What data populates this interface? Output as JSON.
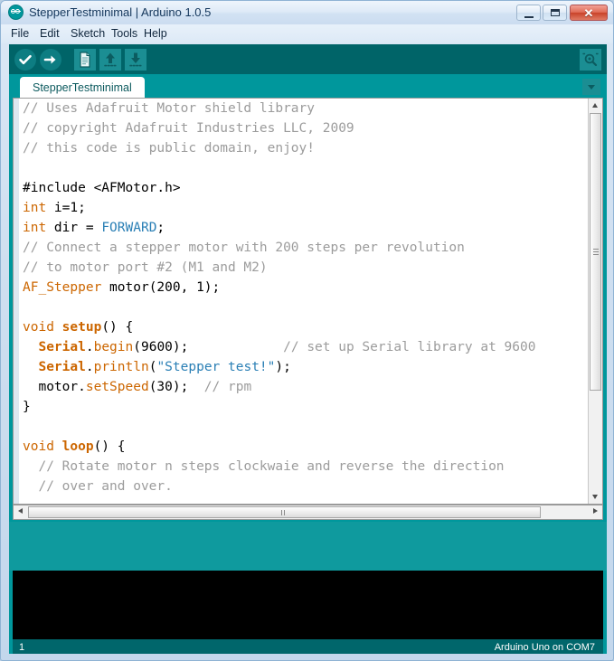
{
  "window": {
    "title": "StepperTestminimal | Arduino 1.0.5",
    "app_icon": "arduino-logo-icon",
    "controls": {
      "minimize": "minimize-icon",
      "maximize": "maximize-icon",
      "close_label": "✕"
    }
  },
  "menubar": {
    "items": [
      {
        "label": "File"
      },
      {
        "label": "Edit"
      },
      {
        "label": "Sketch"
      },
      {
        "label": "Tools"
      },
      {
        "label": "Help"
      }
    ]
  },
  "toolbar": {
    "buttons": [
      {
        "name": "verify-button",
        "icon": "checkmark-icon",
        "tooltip": "Verify"
      },
      {
        "name": "upload-button",
        "icon": "arrow-right-icon",
        "tooltip": "Upload"
      },
      {
        "name": "new-button",
        "icon": "document-icon",
        "tooltip": "New"
      },
      {
        "name": "open-button",
        "icon": "arrow-up-icon",
        "tooltip": "Open"
      },
      {
        "name": "save-button",
        "icon": "arrow-down-icon",
        "tooltip": "Save"
      }
    ],
    "serial_monitor": {
      "name": "serial-monitor-button",
      "icon": "magnifier-icon",
      "tooltip": "Serial Monitor"
    }
  },
  "tabbar": {
    "active_tab": "StepperTestminimal",
    "menu_icon": "chevron-down-icon"
  },
  "editor": {
    "lines": [
      [
        {
          "t": "// Uses Adafruit Motor shield library",
          "c": "cm"
        }
      ],
      [
        {
          "t": "// copyright Adafruit Industries LLC, 2009",
          "c": "cm"
        }
      ],
      [
        {
          "t": "// this code is public domain, enjoy!",
          "c": "cm"
        }
      ],
      [],
      [
        {
          "t": "#include <AFMotor.h>",
          "c": "pl"
        }
      ],
      [
        {
          "t": "int",
          "c": "kw"
        },
        {
          "t": " i=1;",
          "c": "pl"
        }
      ],
      [
        {
          "t": "int",
          "c": "kw"
        },
        {
          "t": " dir = ",
          "c": "pl"
        },
        {
          "t": "FORWARD",
          "c": "lit"
        },
        {
          "t": ";",
          "c": "pl"
        }
      ],
      [
        {
          "t": "// Connect a stepper motor with 200 steps per revolution",
          "c": "cm"
        }
      ],
      [
        {
          "t": "// to motor port #2 (M1 and M2)",
          "c": "cm"
        }
      ],
      [
        {
          "t": "AF_Stepper",
          "c": "kw"
        },
        {
          "t": " motor(200, 1);",
          "c": "pl"
        }
      ],
      [],
      [
        {
          "t": "void",
          "c": "kw"
        },
        {
          "t": " ",
          "c": "pl"
        },
        {
          "t": "setup",
          "c": "kwb"
        },
        {
          "t": "() {",
          "c": "pl"
        }
      ],
      [
        {
          "t": "  ",
          "c": "pl"
        },
        {
          "t": "Serial",
          "c": "kwb"
        },
        {
          "t": ".",
          "c": "pl"
        },
        {
          "t": "begin",
          "c": "fn"
        },
        {
          "t": "(9600);            ",
          "c": "pl"
        },
        {
          "t": "// set up Serial library at 9600",
          "c": "cm"
        }
      ],
      [
        {
          "t": "  ",
          "c": "pl"
        },
        {
          "t": "Serial",
          "c": "kwb"
        },
        {
          "t": ".",
          "c": "pl"
        },
        {
          "t": "println",
          "c": "fn"
        },
        {
          "t": "(",
          "c": "pl"
        },
        {
          "t": "\"Stepper test!\"",
          "c": "str"
        },
        {
          "t": ");",
          "c": "pl"
        }
      ],
      [
        {
          "t": "  motor.",
          "c": "pl"
        },
        {
          "t": "setSpeed",
          "c": "fn"
        },
        {
          "t": "(30);  ",
          "c": "pl"
        },
        {
          "t": "// rpm",
          "c": "cm"
        }
      ],
      [
        {
          "t": "}",
          "c": "pl"
        }
      ],
      [],
      [
        {
          "t": "void",
          "c": "kw"
        },
        {
          "t": " ",
          "c": "pl"
        },
        {
          "t": "loop",
          "c": "kwb"
        },
        {
          "t": "() {",
          "c": "pl"
        }
      ],
      [
        {
          "t": "  ",
          "c": "pl"
        },
        {
          "t": "// Rotate motor n steps clockwaie and reverse the direction",
          "c": "cm"
        }
      ],
      [
        {
          "t": "  ",
          "c": "pl"
        },
        {
          "t": "// over and over.",
          "c": "cm"
        }
      ]
    ]
  },
  "statusbar": {
    "line_number": "1",
    "board_info": "Arduino Uno on COM7"
  },
  "colors": {
    "accent_teal": "#00979c",
    "toolbar_dark": "#006468",
    "status_dark": "#00666b",
    "keyword": "#cc6600",
    "comment": "#9c9c9c",
    "string": "#2a7fb5",
    "console_bg": "#000000"
  }
}
